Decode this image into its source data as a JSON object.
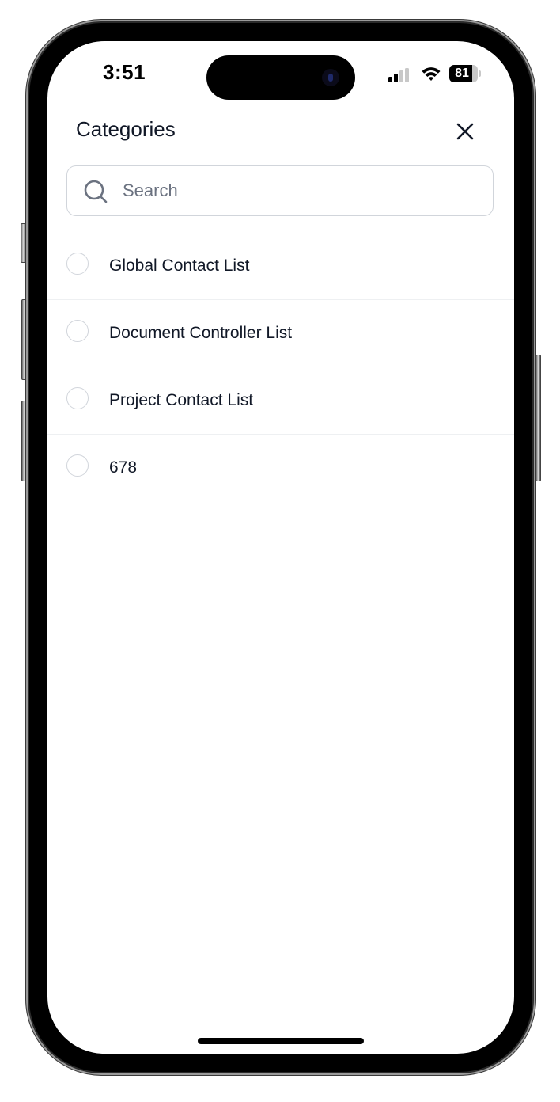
{
  "status_bar": {
    "time": "3:51",
    "battery_level": "81",
    "battery_fraction": 0.81,
    "signal_bars_active": 2,
    "signal_bars_total": 4,
    "icons": [
      "cellular-signal-icon",
      "wifi-icon",
      "battery-icon"
    ]
  },
  "header": {
    "title": "Categories",
    "close_icon": "close-icon"
  },
  "search": {
    "placeholder": "Search",
    "value": "",
    "icon": "search-icon"
  },
  "categories": [
    {
      "label": "Global Contact List",
      "selected": false
    },
    {
      "label": "Document Controller List",
      "selected": false
    },
    {
      "label": "Project Contact List",
      "selected": false
    },
    {
      "label": "678",
      "selected": false
    }
  ],
  "colors": {
    "text_primary": "#111827",
    "placeholder": "#6b7280",
    "border": "#d1d5db",
    "divider": "#eef0f2",
    "search_icon": "#6b7280"
  }
}
